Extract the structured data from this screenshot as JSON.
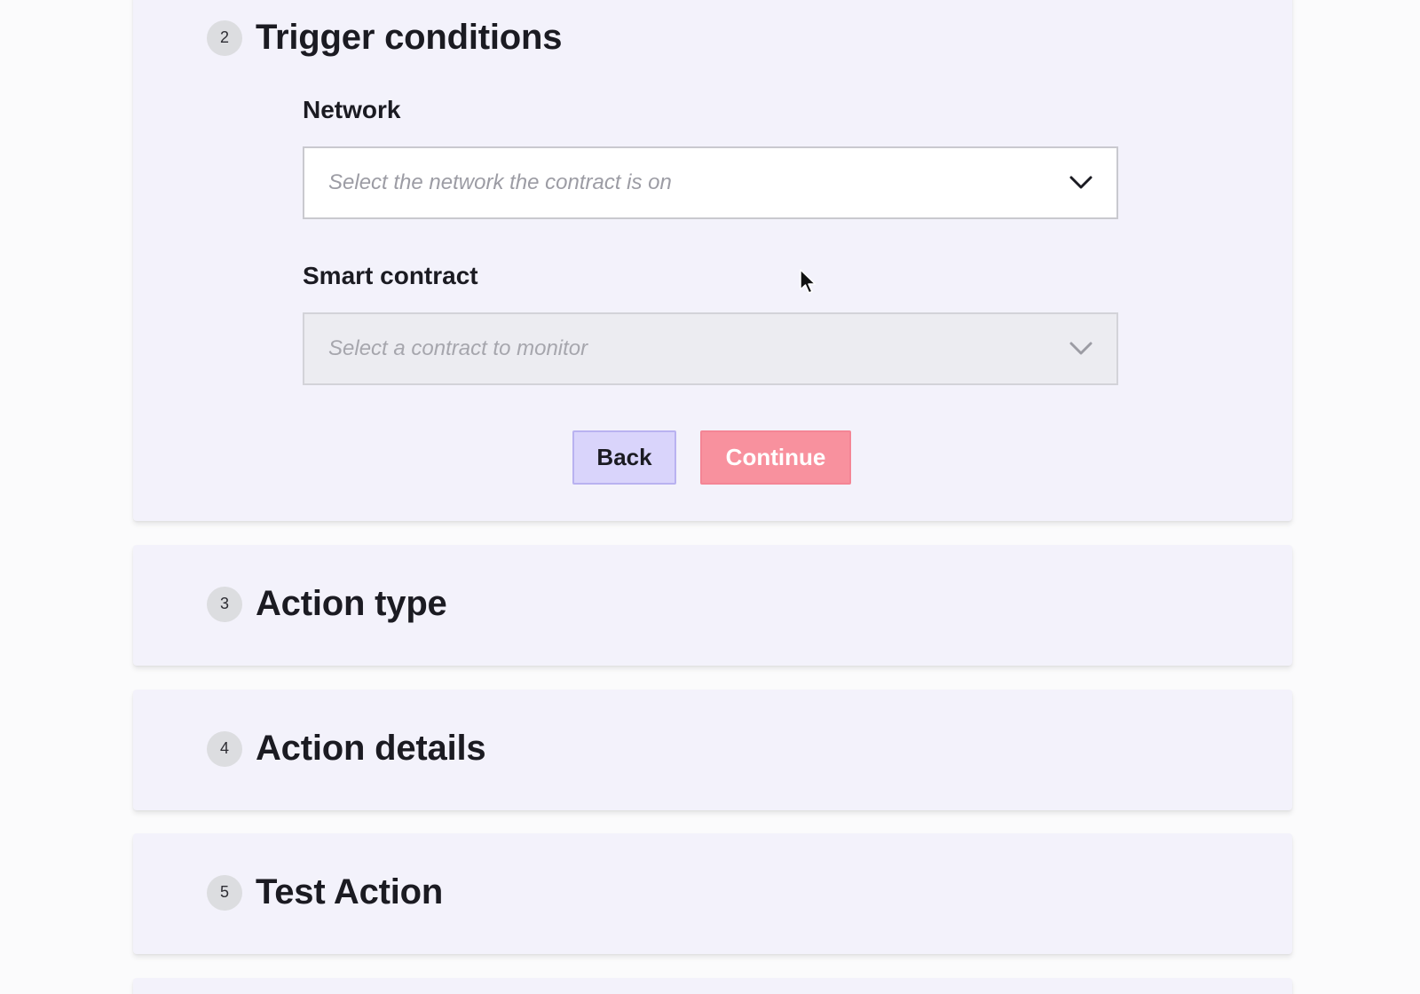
{
  "steps": {
    "trigger": {
      "number": "2",
      "title": "Trigger conditions",
      "network_label": "Network",
      "network_placeholder": "Select the network the contract is on",
      "contract_label": "Smart contract",
      "contract_placeholder": "Select a contract to monitor",
      "back_label": "Back",
      "continue_label": "Continue"
    },
    "action_type": {
      "number": "3",
      "title": "Action type"
    },
    "action_details": {
      "number": "4",
      "title": "Action details"
    },
    "test_action": {
      "number": "5",
      "title": "Test Action"
    }
  },
  "colors": {
    "card_bg": "#f3f2fb",
    "back_button": "#d9d4fb",
    "continue_button": "#f8919e"
  },
  "icons": {
    "dropdown": "chevron-down-icon",
    "cursor": "mouse-pointer-icon"
  }
}
